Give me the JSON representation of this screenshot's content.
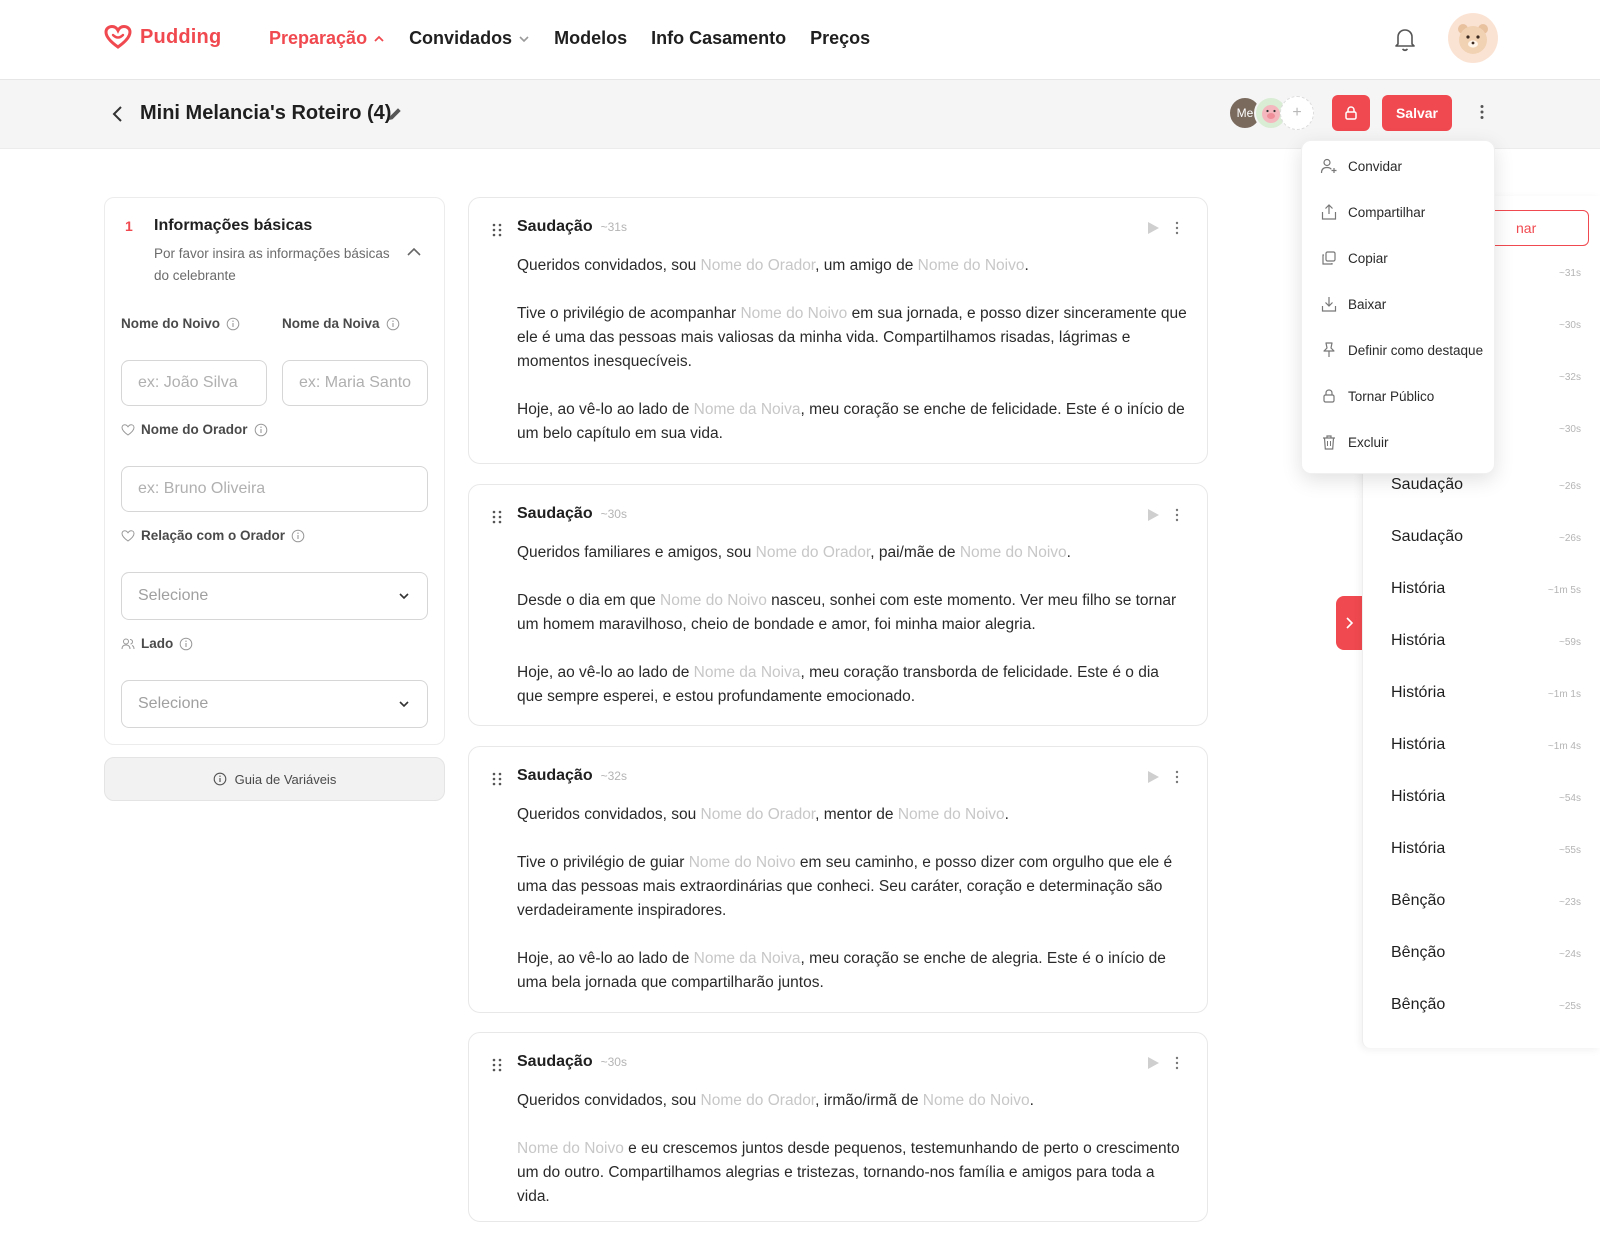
{
  "brand": {
    "name": "Pudding",
    "color": "#f0494f"
  },
  "nav": {
    "items": [
      {
        "label": "Preparação",
        "active": true,
        "has_chevron": true
      },
      {
        "label": "Convidados",
        "active": false,
        "has_chevron": true
      },
      {
        "label": "Modelos",
        "active": false,
        "has_chevron": false
      },
      {
        "label": "Info Casamento",
        "active": false,
        "has_chevron": false
      },
      {
        "label": "Preços",
        "active": false,
        "has_chevron": false
      }
    ]
  },
  "header": {
    "title": "Mini Melancia's Roteiro (4)",
    "collaborator_initials": "Me",
    "save_label": "Salvar"
  },
  "form": {
    "step": "1",
    "title": "Informações básicas",
    "subtitle": "Por favor insira as informações básicas do celebrante",
    "groom_label": "Nome do Noivo",
    "groom_placeholder": "ex: João Silva",
    "bride_label": "Nome da Noiva",
    "bride_placeholder": "ex: Maria Santo",
    "speaker_label": "Nome do Orador",
    "speaker_placeholder": "ex: Bruno Oliveira",
    "relation_label": "Relação com o Orador",
    "relation_value": "Selecione",
    "side_label": "Lado",
    "side_value": "Selecione",
    "guide_label": "Guia de Variáveis"
  },
  "blocks": [
    {
      "title": "Saudação",
      "time": "~31s",
      "paragraphs": [
        [
          {
            "t": "Queridos convidados, sou "
          },
          {
            "v": "Nome do Orador"
          },
          {
            "t": ", um amigo de "
          },
          {
            "v": "Nome do Noivo"
          },
          {
            "t": "."
          }
        ],
        [
          {
            "t": "Tive o privilégio de acompanhar "
          },
          {
            "v": "Nome do Noivo"
          },
          {
            "t": " em sua jornada, e posso dizer sinceramente que ele é uma das pessoas mais valiosas da minha vida. Compartilhamos risadas, lágrimas e momentos inesquecíveis."
          }
        ],
        [
          {
            "t": "Hoje, ao vê-lo ao lado de "
          },
          {
            "v": "Nome da Noiva"
          },
          {
            "t": ", meu coração se enche de felicidade. Este é o início de um belo capítulo em sua vida."
          }
        ]
      ]
    },
    {
      "title": "Saudação",
      "time": "~30s",
      "paragraphs": [
        [
          {
            "t": "Queridos familiares e amigos, sou "
          },
          {
            "v": "Nome do Orador"
          },
          {
            "t": ", pai/mãe de "
          },
          {
            "v": "Nome do Noivo"
          },
          {
            "t": "."
          }
        ],
        [
          {
            "t": "Desde o dia em que "
          },
          {
            "v": "Nome do Noivo"
          },
          {
            "t": " nasceu, sonhei com este momento. Ver meu filho se tornar um homem maravilhoso, cheio de bondade e amor, foi minha maior alegria."
          }
        ],
        [
          {
            "t": "Hoje, ao vê-lo ao lado de "
          },
          {
            "v": "Nome da Noiva"
          },
          {
            "t": ", meu coração transborda de felicidade. Este é o dia que sempre esperei, e estou profundamente emocionado."
          }
        ]
      ]
    },
    {
      "title": "Saudação",
      "time": "~32s",
      "paragraphs": [
        [
          {
            "t": "Queridos convidados, sou "
          },
          {
            "v": "Nome do Orador"
          },
          {
            "t": ", mentor de "
          },
          {
            "v": "Nome do Noivo"
          },
          {
            "t": "."
          }
        ],
        [
          {
            "t": "Tive o privilégio de guiar "
          },
          {
            "v": "Nome do Noivo"
          },
          {
            "t": " em seu caminho, e posso dizer com orgulho que ele é uma das pessoas mais extraordinárias que conheci. Seu caráter, coração e determinação são verdadeiramente inspiradores."
          }
        ],
        [
          {
            "t": "Hoje, ao vê-lo ao lado de "
          },
          {
            "v": "Nome da Noiva"
          },
          {
            "t": ", meu coração se enche de alegria. Este é o início de uma bela jornada que compartilharão juntos."
          }
        ]
      ]
    },
    {
      "title": "Saudação",
      "time": "~30s",
      "paragraphs": [
        [
          {
            "t": "Queridos convidados, sou "
          },
          {
            "v": "Nome do Orador"
          },
          {
            "t": ", irmão/irmã de "
          },
          {
            "v": "Nome do Noivo"
          },
          {
            "t": "."
          }
        ],
        [
          {
            "v": "Nome do Noivo"
          },
          {
            "t": " e eu crescemos juntos desde pequenos, testemunhando de perto o crescimento um do outro. Compartilhamos alegrias e tristezas, tornando-nos família e amigos para toda a vida."
          }
        ]
      ]
    }
  ],
  "outline": {
    "button_label": "nar",
    "items": [
      {
        "name": "",
        "time": "~31s"
      },
      {
        "name": "",
        "time": "~30s"
      },
      {
        "name": "",
        "time": "~32s"
      },
      {
        "name": "",
        "time": "~30s"
      },
      {
        "name": "Saudação",
        "time": "~26s"
      },
      {
        "name": "Saudação",
        "time": "~26s"
      },
      {
        "name": "História",
        "time": "~1m 5s"
      },
      {
        "name": "História",
        "time": "~59s"
      },
      {
        "name": "História",
        "time": "~1m 1s"
      },
      {
        "name": "História",
        "time": "~1m 4s"
      },
      {
        "name": "História",
        "time": "~54s"
      },
      {
        "name": "História",
        "time": "~55s"
      },
      {
        "name": "Bênção",
        "time": "~23s"
      },
      {
        "name": "Bênção",
        "time": "~24s"
      },
      {
        "name": "Bênção",
        "time": "~25s"
      }
    ]
  },
  "menu": {
    "items": [
      {
        "label": "Convidar",
        "icon": "user-plus-icon"
      },
      {
        "label": "Compartilhar",
        "icon": "share-icon"
      },
      {
        "label": "Copiar",
        "icon": "copy-icon"
      },
      {
        "label": "Baixar",
        "icon": "download-icon"
      },
      {
        "label": "Definir como destaque",
        "icon": "pin-icon"
      },
      {
        "label": "Tornar Público",
        "icon": "lock-icon"
      },
      {
        "label": "Excluir",
        "icon": "trash-icon"
      }
    ]
  }
}
